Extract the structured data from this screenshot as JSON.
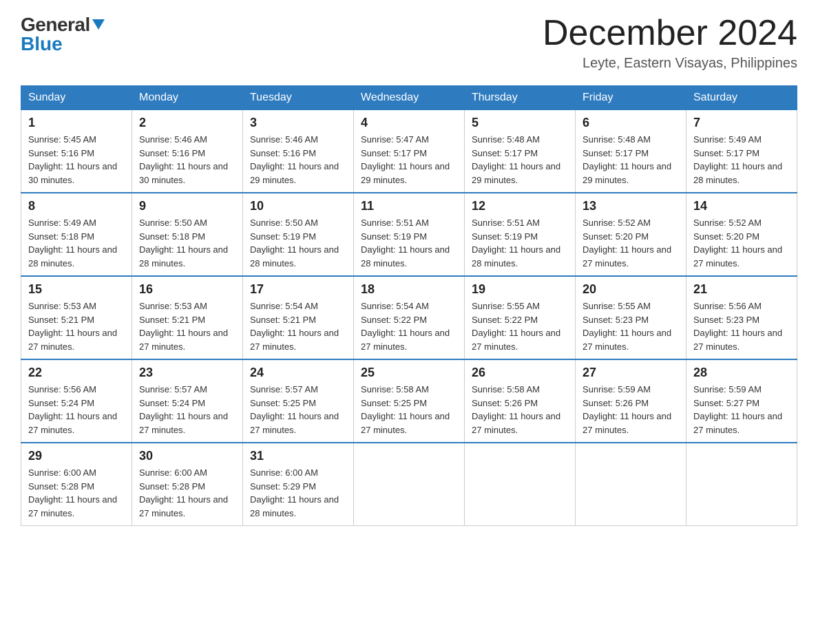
{
  "header": {
    "logo_top": "General",
    "logo_bottom": "Blue",
    "month_title": "December 2024",
    "subtitle": "Leyte, Eastern Visayas, Philippines"
  },
  "days_of_week": [
    "Sunday",
    "Monday",
    "Tuesday",
    "Wednesday",
    "Thursday",
    "Friday",
    "Saturday"
  ],
  "weeks": [
    [
      {
        "day": "1",
        "sunrise": "5:45 AM",
        "sunset": "5:16 PM",
        "daylight": "11 hours and 30 minutes."
      },
      {
        "day": "2",
        "sunrise": "5:46 AM",
        "sunset": "5:16 PM",
        "daylight": "11 hours and 30 minutes."
      },
      {
        "day": "3",
        "sunrise": "5:46 AM",
        "sunset": "5:16 PM",
        "daylight": "11 hours and 29 minutes."
      },
      {
        "day": "4",
        "sunrise": "5:47 AM",
        "sunset": "5:17 PM",
        "daylight": "11 hours and 29 minutes."
      },
      {
        "day": "5",
        "sunrise": "5:48 AM",
        "sunset": "5:17 PM",
        "daylight": "11 hours and 29 minutes."
      },
      {
        "day": "6",
        "sunrise": "5:48 AM",
        "sunset": "5:17 PM",
        "daylight": "11 hours and 29 minutes."
      },
      {
        "day": "7",
        "sunrise": "5:49 AM",
        "sunset": "5:17 PM",
        "daylight": "11 hours and 28 minutes."
      }
    ],
    [
      {
        "day": "8",
        "sunrise": "5:49 AM",
        "sunset": "5:18 PM",
        "daylight": "11 hours and 28 minutes."
      },
      {
        "day": "9",
        "sunrise": "5:50 AM",
        "sunset": "5:18 PM",
        "daylight": "11 hours and 28 minutes."
      },
      {
        "day": "10",
        "sunrise": "5:50 AM",
        "sunset": "5:19 PM",
        "daylight": "11 hours and 28 minutes."
      },
      {
        "day": "11",
        "sunrise": "5:51 AM",
        "sunset": "5:19 PM",
        "daylight": "11 hours and 28 minutes."
      },
      {
        "day": "12",
        "sunrise": "5:51 AM",
        "sunset": "5:19 PM",
        "daylight": "11 hours and 28 minutes."
      },
      {
        "day": "13",
        "sunrise": "5:52 AM",
        "sunset": "5:20 PM",
        "daylight": "11 hours and 27 minutes."
      },
      {
        "day": "14",
        "sunrise": "5:52 AM",
        "sunset": "5:20 PM",
        "daylight": "11 hours and 27 minutes."
      }
    ],
    [
      {
        "day": "15",
        "sunrise": "5:53 AM",
        "sunset": "5:21 PM",
        "daylight": "11 hours and 27 minutes."
      },
      {
        "day": "16",
        "sunrise": "5:53 AM",
        "sunset": "5:21 PM",
        "daylight": "11 hours and 27 minutes."
      },
      {
        "day": "17",
        "sunrise": "5:54 AM",
        "sunset": "5:21 PM",
        "daylight": "11 hours and 27 minutes."
      },
      {
        "day": "18",
        "sunrise": "5:54 AM",
        "sunset": "5:22 PM",
        "daylight": "11 hours and 27 minutes."
      },
      {
        "day": "19",
        "sunrise": "5:55 AM",
        "sunset": "5:22 PM",
        "daylight": "11 hours and 27 minutes."
      },
      {
        "day": "20",
        "sunrise": "5:55 AM",
        "sunset": "5:23 PM",
        "daylight": "11 hours and 27 minutes."
      },
      {
        "day": "21",
        "sunrise": "5:56 AM",
        "sunset": "5:23 PM",
        "daylight": "11 hours and 27 minutes."
      }
    ],
    [
      {
        "day": "22",
        "sunrise": "5:56 AM",
        "sunset": "5:24 PM",
        "daylight": "11 hours and 27 minutes."
      },
      {
        "day": "23",
        "sunrise": "5:57 AM",
        "sunset": "5:24 PM",
        "daylight": "11 hours and 27 minutes."
      },
      {
        "day": "24",
        "sunrise": "5:57 AM",
        "sunset": "5:25 PM",
        "daylight": "11 hours and 27 minutes."
      },
      {
        "day": "25",
        "sunrise": "5:58 AM",
        "sunset": "5:25 PM",
        "daylight": "11 hours and 27 minutes."
      },
      {
        "day": "26",
        "sunrise": "5:58 AM",
        "sunset": "5:26 PM",
        "daylight": "11 hours and 27 minutes."
      },
      {
        "day": "27",
        "sunrise": "5:59 AM",
        "sunset": "5:26 PM",
        "daylight": "11 hours and 27 minutes."
      },
      {
        "day": "28",
        "sunrise": "5:59 AM",
        "sunset": "5:27 PM",
        "daylight": "11 hours and 27 minutes."
      }
    ],
    [
      {
        "day": "29",
        "sunrise": "6:00 AM",
        "sunset": "5:28 PM",
        "daylight": "11 hours and 27 minutes."
      },
      {
        "day": "30",
        "sunrise": "6:00 AM",
        "sunset": "5:28 PM",
        "daylight": "11 hours and 27 minutes."
      },
      {
        "day": "31",
        "sunrise": "6:00 AM",
        "sunset": "5:29 PM",
        "daylight": "11 hours and 28 minutes."
      },
      null,
      null,
      null,
      null
    ]
  ]
}
